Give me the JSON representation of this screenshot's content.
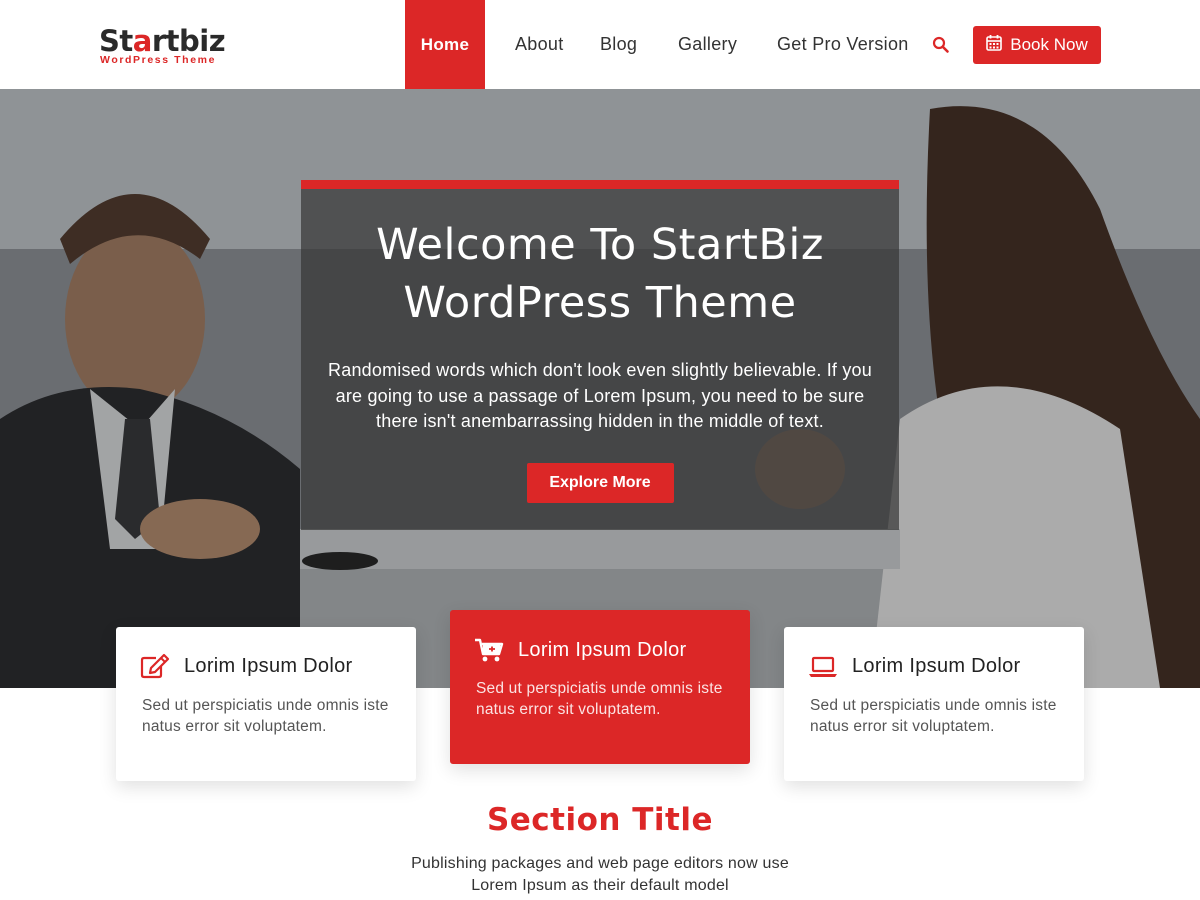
{
  "brand": {
    "logo_prefix": "St",
    "logo_accent": "a",
    "logo_suffix": "rtbiz",
    "tagline": "WordPress Theme",
    "accent_color": "#dc2727"
  },
  "nav": {
    "items": [
      {
        "label": "Home",
        "active": true
      },
      {
        "label": "About"
      },
      {
        "label": "Blog"
      },
      {
        "label": "Gallery"
      },
      {
        "label": "Get Pro Version"
      }
    ],
    "search_icon": "search-icon",
    "book_label": "Book Now",
    "book_icon": "calendar-icon"
  },
  "hero": {
    "title_line1": "Welcome To StartBiz",
    "title_line2": "WordPress Theme",
    "text": "Randomised words which don't look even slightly believable. If you are going to use a passage of Lorem Ipsum, you need to be sure there isn't anembarrassing hidden in the middle of text.",
    "button_label": "Explore More"
  },
  "features": [
    {
      "icon": "edit-icon",
      "title": "Lorim Ipsum Dolor",
      "text": "Sed ut perspiciatis unde omnis iste natus error sit voluptatem."
    },
    {
      "icon": "cart-icon",
      "title": "Lorim Ipsum Dolor",
      "text": "Sed ut perspiciatis unde omnis iste natus error sit voluptatem."
    },
    {
      "icon": "laptop-icon",
      "title": "Lorim Ipsum Dolor",
      "text": "Sed ut perspiciatis unde omnis iste natus error sit voluptatem."
    }
  ],
  "section": {
    "title": "Section Title",
    "text": "Publishing packages and web page editors now use Lorem Ipsum as their default model"
  }
}
